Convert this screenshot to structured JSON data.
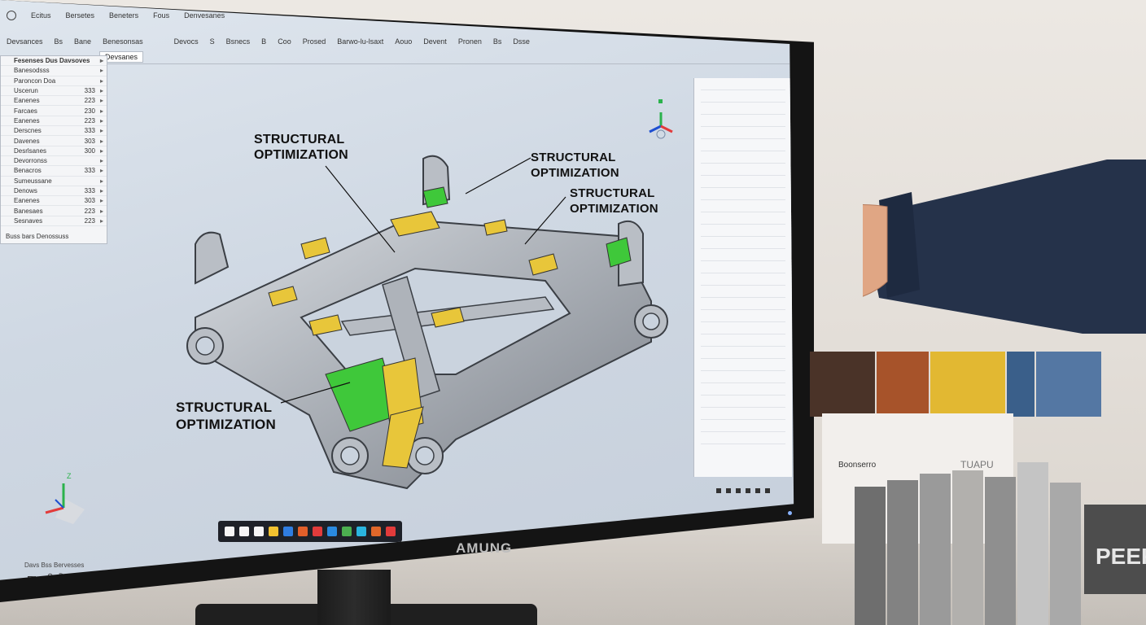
{
  "window": {
    "menu": [
      "Ecitus",
      "Bersetes",
      "Beneters",
      "Fous",
      "Denvesanes"
    ],
    "ribbon": [
      "Devsances",
      "Bs",
      "Bane",
      "Benesonsas"
    ],
    "toolbar": [
      "Devocs",
      "S",
      "Bsnecs",
      "B",
      "Coo",
      "Prosed",
      "Barwo-lu-lsaxt",
      "Aouo",
      "Devent",
      "Pronen",
      "Bs",
      "Dsse"
    ],
    "tab": "Devsanes"
  },
  "tree": {
    "header": "Fesenses Dus Davsoves",
    "items": [
      {
        "label": "Banesodsss",
        "num": ""
      },
      {
        "label": "Paroncon Doa",
        "num": ""
      },
      {
        "label": "Uscerun",
        "num": "333"
      },
      {
        "label": "Eanenes",
        "num": "223"
      },
      {
        "label": "Farcaes",
        "num": "230"
      },
      {
        "label": "Eanenes",
        "num": "223"
      },
      {
        "label": "Derscnes",
        "num": "333"
      },
      {
        "label": "Davenes",
        "num": "303"
      },
      {
        "label": "Desrlsanes",
        "num": "300"
      },
      {
        "label": "Devorronss",
        "num": ""
      },
      {
        "label": "Benacros",
        "num": "333"
      },
      {
        "label": "Sumeussane",
        "num": ""
      },
      {
        "label": "Denows",
        "num": "333"
      },
      {
        "label": "Eanenes",
        "num": "303"
      },
      {
        "label": "Banesaes",
        "num": "223"
      },
      {
        "label": "Sesnaves",
        "num": "223"
      }
    ],
    "status": "Buss bars Denossuss"
  },
  "callouts": [
    {
      "line1": "STRUCTURAL",
      "line2": "OPTIMIZATION"
    },
    {
      "line1": "STRUCTURAL",
      "line2": "OPTIMIZATION"
    },
    {
      "line1": "STRUCTURAL",
      "line2": "OPTIMIZATION"
    },
    {
      "line1": "STRUCTURAL",
      "line2": "OPTIMIZATION"
    }
  ],
  "triad_labels": {
    "z": "Z"
  },
  "taskbar": {
    "status": "Davs Bss Bervesses",
    "search": "Devecsnes taruusocs",
    "icon_colors": [
      "#f5f5f5",
      "#f5f5f5",
      "#f5f5f5",
      "#f2c230",
      "#2f7de1",
      "#e25f2a",
      "#e23b3b",
      "#2a8ae0",
      "#4caf50",
      "#2ab5e0",
      "#e0672a",
      "#e23b3b"
    ]
  },
  "monitor": {
    "brand": "AMUNG"
  },
  "samples": {
    "card_label": "Boonserro",
    "card_title": "TUAPU",
    "peek_label": "PEEK",
    "swatch_colors": [
      "#4a3328",
      "#a7532a",
      "#e2b832",
      "#3a5f8a",
      "#5477a3"
    ],
    "tile_colors": [
      "#6e6e6e",
      "#828282",
      "#9a9a9a",
      "#b2b0ad",
      "#8f8f8f",
      "#c4c4c4",
      "#a9a9a9"
    ]
  }
}
